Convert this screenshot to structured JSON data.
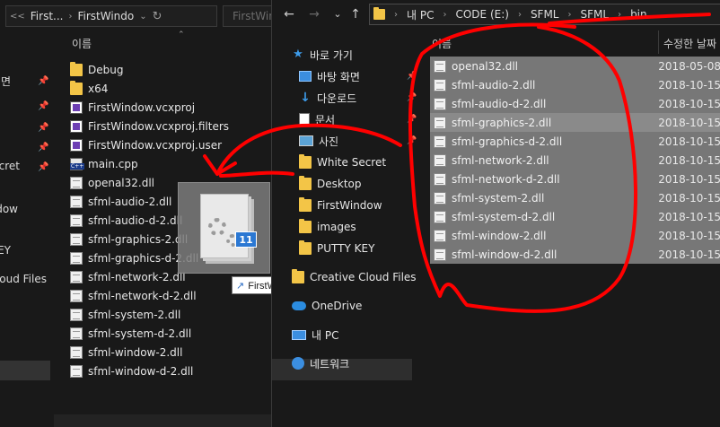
{
  "left_window": {
    "address": {
      "more": "<<",
      "crumbs": [
        "First...",
        "FirstWindo"
      ],
      "refresh_icon": "refresh-icon"
    },
    "search_placeholder": "FirstWin",
    "column_name": "이름",
    "nav_partial": [
      "면",
      "",
      "",
      "",
      "Secret",
      "Window",
      "",
      "KEY",
      "Cloud Files"
    ],
    "items": [
      {
        "name": "Debug",
        "icon": "folder"
      },
      {
        "name": "x64",
        "icon": "folder"
      },
      {
        "name": "FirstWindow.vcxproj",
        "icon": "vcxproj"
      },
      {
        "name": "FirstWindow.vcxproj.filters",
        "icon": "vcxproj"
      },
      {
        "name": "FirstWindow.vcxproj.user",
        "icon": "vcxproj"
      },
      {
        "name": "main.cpp",
        "icon": "cpp"
      },
      {
        "name": "openal32.dll",
        "icon": "dll"
      },
      {
        "name": "sfml-audio-2.dll",
        "icon": "dll"
      },
      {
        "name": "sfml-audio-d-2.dll",
        "icon": "dll"
      },
      {
        "name": "sfml-graphics-2.dll",
        "icon": "dll"
      },
      {
        "name": "sfml-graphics-d-2.dll",
        "icon": "dll"
      },
      {
        "name": "sfml-network-2.dll",
        "icon": "dll"
      },
      {
        "name": "sfml-network-d-2.dll",
        "icon": "dll"
      },
      {
        "name": "sfml-system-2.dll",
        "icon": "dll"
      },
      {
        "name": "sfml-system-d-2.dll",
        "icon": "dll"
      },
      {
        "name": "sfml-window-2.dll",
        "icon": "dll"
      },
      {
        "name": "sfml-window-d-2.dll",
        "icon": "dll"
      }
    ]
  },
  "drag": {
    "count": "11",
    "tooltip": "FirstWindow에 연결 만들기"
  },
  "right_window": {
    "address": {
      "crumbs": [
        "내 PC",
        "CODE (E:)",
        "SFML",
        "SFML",
        "bin"
      ]
    },
    "nav": [
      {
        "label": "바로 가기",
        "icon": "star"
      },
      {
        "label": "바탕 화면",
        "icon": "desktop"
      },
      {
        "label": "다운로드",
        "icon": "download"
      },
      {
        "label": "문서",
        "icon": "document"
      },
      {
        "label": "사진",
        "icon": "pictures"
      },
      {
        "label": "White Secret",
        "icon": "folder"
      },
      {
        "label": "Desktop",
        "icon": "folder"
      },
      {
        "label": "FirstWindow",
        "icon": "folder"
      },
      {
        "label": "images",
        "icon": "folder"
      },
      {
        "label": "PUTTY KEY",
        "icon": "folder"
      },
      {
        "label": "Creative Cloud Files",
        "icon": "folder"
      },
      {
        "label": "OneDrive",
        "icon": "cloud"
      },
      {
        "label": "내 PC",
        "icon": "pc"
      },
      {
        "label": "네트워크",
        "icon": "network"
      }
    ],
    "columns": {
      "name": "이름",
      "date": "수정한 날짜"
    },
    "files": [
      {
        "name": "openal32.dll",
        "date": "2018-05-08"
      },
      {
        "name": "sfml-audio-2.dll",
        "date": "2018-10-15"
      },
      {
        "name": "sfml-audio-d-2.dll",
        "date": "2018-10-15"
      },
      {
        "name": "sfml-graphics-2.dll",
        "date": "2018-10-15"
      },
      {
        "name": "sfml-graphics-d-2.dll",
        "date": "2018-10-15"
      },
      {
        "name": "sfml-network-2.dll",
        "date": "2018-10-15"
      },
      {
        "name": "sfml-network-d-2.dll",
        "date": "2018-10-15"
      },
      {
        "name": "sfml-system-2.dll",
        "date": "2018-10-15"
      },
      {
        "name": "sfml-system-d-2.dll",
        "date": "2018-10-15"
      },
      {
        "name": "sfml-window-2.dll",
        "date": "2018-10-15"
      },
      {
        "name": "sfml-window-d-2.dll",
        "date": "2018-10-15"
      }
    ]
  },
  "colors": {
    "annotation": "#ff0000",
    "folder": "#f3c547",
    "selection_row": "#777777"
  }
}
